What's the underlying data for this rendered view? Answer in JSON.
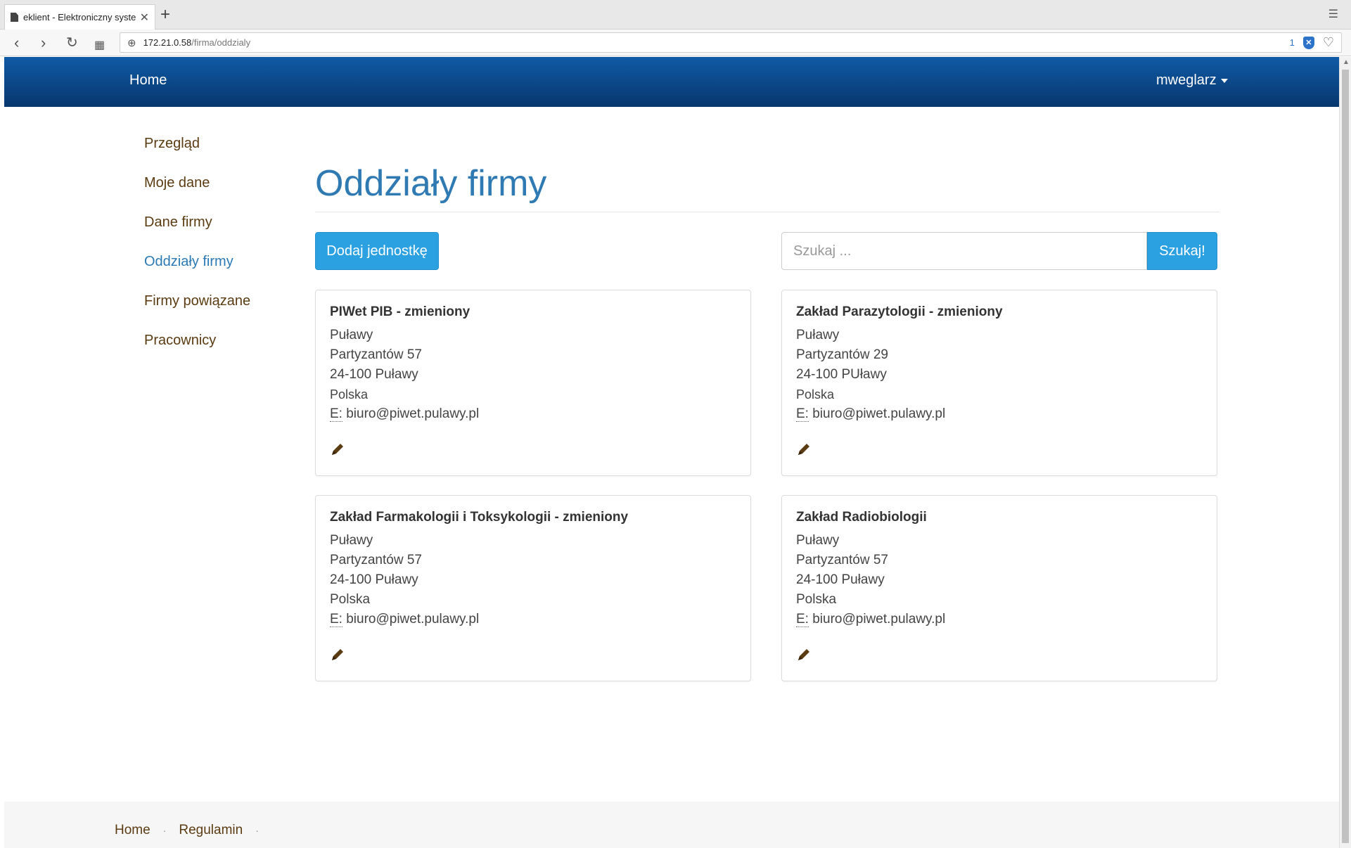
{
  "browser": {
    "tab_title": "eklient - Elektroniczny syste",
    "url_host": "172.21.0.58",
    "url_path": "/firma/oddzialy",
    "shield_count": "1"
  },
  "navbar": {
    "brand": "Home",
    "user": "mweglarz"
  },
  "sidebar": {
    "items": [
      {
        "label": "Przegląd"
      },
      {
        "label": "Moje dane"
      },
      {
        "label": "Dane firmy"
      },
      {
        "label": "Oddziały firmy"
      },
      {
        "label": "Firmy powiązane"
      },
      {
        "label": "Pracownicy"
      }
    ],
    "active_index": 3
  },
  "main": {
    "title": "Oddziały firmy",
    "add_button": "Dodaj jednostkę",
    "search_placeholder": "Szukaj ...",
    "search_button": "Szukaj!"
  },
  "cards": [
    {
      "name": "PIWet PIB - zmieniony",
      "city": "Puławy",
      "street": "Partyzantów 57",
      "postal": "24-100 Puławy",
      "country": "Polska",
      "email_label": "E:",
      "email": "biuro@piwet.pulawy.pl"
    },
    {
      "name": "Zakład Parazytologii - zmieniony",
      "city": "Puławy",
      "street": "Partyzantów 29",
      "postal": "24-100 PUławy",
      "country": "Polska",
      "email_label": "E:",
      "email": "biuro@piwet.pulawy.pl"
    },
    {
      "name": "Zakład Farmakologii i Toksykologii - zmieniony",
      "city": "Puławy",
      "street": "Partyzantów 57",
      "postal": "24-100 Puławy",
      "country": "Polska",
      "email_label": "E:",
      "email": "biuro@piwet.pulawy.pl"
    },
    {
      "name": "Zakład Radiobiologii",
      "city": "Puławy",
      "street": "Partyzantów 57",
      "postal": "24-100 Puławy",
      "country": "Polska",
      "email_label": "E:",
      "email": "biuro@piwet.pulawy.pl"
    }
  ],
  "footer": {
    "links": [
      {
        "label": "Home"
      },
      {
        "label": "Regulamin"
      }
    ],
    "separator": "·"
  },
  "colors": {
    "navbar_top": "#0f5aa6",
    "navbar_bottom": "#08376d",
    "accent": "#2f7ab3",
    "button": "#2ba1e2",
    "link": "#5a3b12"
  }
}
